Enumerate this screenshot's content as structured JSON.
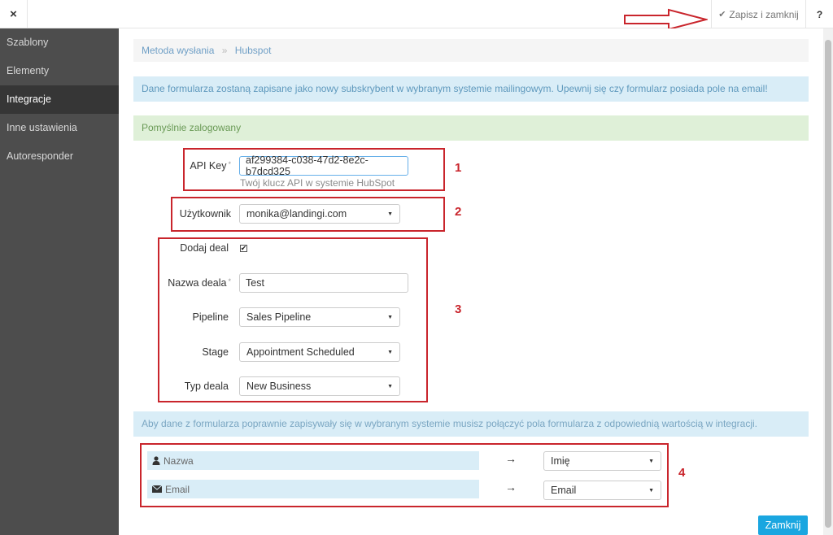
{
  "topbar": {
    "close_label": "×",
    "save_label": "Zapisz i zamknij",
    "help_label": "?"
  },
  "sidebar": {
    "items": [
      {
        "label": "Szablony"
      },
      {
        "label": "Elementy"
      },
      {
        "label": "Integracje"
      },
      {
        "label": "Inne ustawienia"
      },
      {
        "label": "Autoresponder"
      }
    ]
  },
  "breadcrumb": {
    "parent": "Metoda wysłania",
    "separator": "»",
    "current": "Hubspot"
  },
  "alerts": {
    "info": "Dane formularza zostaną zapisane jako nowy subskrybent w wybranym systemie mailingowym. Upewnij się czy formularz posiada pole na email!",
    "success": "Pomyślnie zalogowany",
    "mapping_info": "Aby dane z formularza poprawnie zapisywały się w wybranym systemie musisz połączyć pola formularza z odpowiednią wartością w integracji."
  },
  "form": {
    "api_key": {
      "label": "API Key",
      "required_mark": "*",
      "value": "af299384-c038-47d2-8e2c-b7dcd325",
      "help": "Twój klucz API w systemie HubSpot"
    },
    "user": {
      "label": "Użytkownik",
      "value": "monika@landingi.com"
    },
    "add_deal": {
      "label": "Dodaj deal",
      "checked": true,
      "check_mark": "✔"
    },
    "deal_name": {
      "label": "Nazwa deala",
      "required_mark": "*",
      "value": "Test"
    },
    "pipeline": {
      "label": "Pipeline",
      "value": "Sales Pipeline"
    },
    "stage": {
      "label": "Stage",
      "value": "Appointment Scheduled"
    },
    "deal_type": {
      "label": "Typ deala",
      "value": "New Business"
    }
  },
  "mapping": {
    "arrow": "→",
    "rows": [
      {
        "field": "Nazwa",
        "icon": "user-icon",
        "target": "Imię"
      },
      {
        "field": "Email",
        "icon": "envelope-icon",
        "target": "Email"
      }
    ]
  },
  "annotations": {
    "n1": "1",
    "n2": "2",
    "n3": "3",
    "n4": "4"
  },
  "footer": {
    "close_label": "Zamknij"
  },
  "colors": {
    "annotation_red": "#c9252c",
    "primary_button": "#1aa6e0",
    "sidebar_bg": "#4d4d4d"
  }
}
